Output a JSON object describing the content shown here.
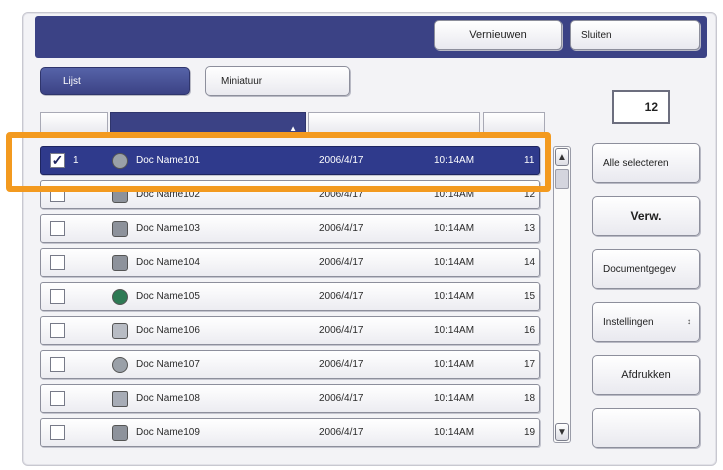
{
  "toolbar": {
    "refresh_label": "Vernieuwen",
    "close_label": "Sluiten"
  },
  "view_tabs": {
    "list_label": "Lijst",
    "thumbnail_label": "Miniatuur"
  },
  "document_count": "12",
  "rows": [
    {
      "num": "1",
      "name": "Doc Name101",
      "date": "2006/4/17",
      "time": "10:14AM",
      "pages": "11",
      "checked": true,
      "icon": "monitor-doc-icon"
    },
    {
      "num": "",
      "name": "Doc Name102",
      "date": "2006/4/17",
      "time": "10:14AM",
      "pages": "12",
      "checked": false,
      "icon": "printer-doc-icon"
    },
    {
      "num": "",
      "name": "Doc Name103",
      "date": "2006/4/17",
      "time": "10:14AM",
      "pages": "13",
      "checked": false,
      "icon": "printer-doc-icon"
    },
    {
      "num": "",
      "name": "Doc Name104",
      "date": "2006/4/17",
      "time": "10:14AM",
      "pages": "14",
      "checked": false,
      "icon": "printer-doc-icon"
    },
    {
      "num": "",
      "name": "Doc Name105",
      "date": "2006/4/17",
      "time": "10:14AM",
      "pages": "15",
      "checked": false,
      "icon": "globe-doc-icon"
    },
    {
      "num": "",
      "name": "Doc Name106",
      "date": "2006/4/17",
      "time": "10:14AM",
      "pages": "16",
      "checked": false,
      "icon": "box-doc-icon"
    },
    {
      "num": "",
      "name": "Doc Name107",
      "date": "2006/4/17",
      "time": "10:14AM",
      "pages": "17",
      "checked": false,
      "icon": "scanner-doc-icon"
    },
    {
      "num": "",
      "name": "Doc Name108",
      "date": "2006/4/17",
      "time": "10:14AM",
      "pages": "18",
      "checked": false,
      "icon": "folder-doc-icon"
    },
    {
      "num": "",
      "name": "Doc Name109",
      "date": "2006/4/17",
      "time": "10:14AM",
      "pages": "19",
      "checked": false,
      "icon": "printer-doc-icon"
    }
  ],
  "side_buttons": {
    "select_all": "Alle selecteren",
    "delete": "Verw.",
    "doc_details": "Documentgegev",
    "settings": "Instellingen",
    "print": "Afdrukken"
  },
  "colors": {
    "accent_navy": "#3b4285",
    "selected_row": "#2f3a8c",
    "highlight_orange": "#f39a1f"
  }
}
